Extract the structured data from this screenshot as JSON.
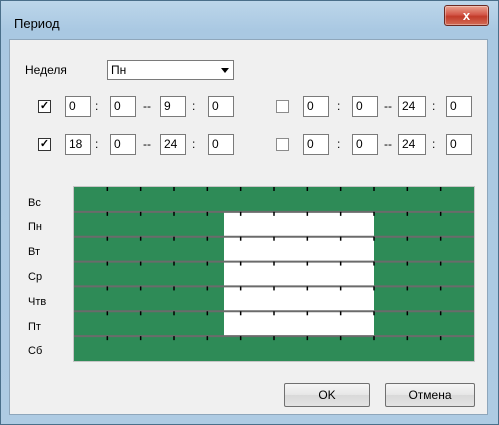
{
  "window": {
    "title": "Период",
    "close_glyph": "x"
  },
  "week": {
    "label": "Неделя",
    "selected": "Пн"
  },
  "periods": [
    {
      "checked": true,
      "start_h": "0",
      "start_m": "0",
      "end_h": "9",
      "end_m": "0"
    },
    {
      "checked": false,
      "start_h": "0",
      "start_m": "0",
      "end_h": "24",
      "end_m": "0"
    },
    {
      "checked": true,
      "start_h": "18",
      "start_m": "0",
      "end_h": "24",
      "end_m": "0"
    },
    {
      "checked": false,
      "start_h": "0",
      "start_m": "0",
      "end_h": "24",
      "end_m": "0"
    }
  ],
  "separators": {
    "colon": ":",
    "dash": "--"
  },
  "schedule": {
    "days": [
      "Вс",
      "Пн",
      "Вт",
      "Ср",
      "Чтв",
      "Пт",
      "Сб"
    ],
    "hours_per_day": 24,
    "active": [
      [
        [
          0,
          24
        ]
      ],
      [
        [
          0,
          9
        ],
        [
          18,
          24
        ]
      ],
      [
        [
          0,
          9
        ],
        [
          18,
          24
        ]
      ],
      [
        [
          0,
          9
        ],
        [
          18,
          24
        ]
      ],
      [
        [
          0,
          9
        ],
        [
          18,
          24
        ]
      ],
      [
        [
          0,
          9
        ],
        [
          18,
          24
        ]
      ],
      [
        [
          0,
          24
        ]
      ]
    ],
    "colors": {
      "active": "#2e8b57",
      "inactive": "#ffffff",
      "grid": "#6b6b6b",
      "tick": "#000000"
    }
  },
  "buttons": {
    "ok": "OK",
    "cancel": "Отмена"
  }
}
